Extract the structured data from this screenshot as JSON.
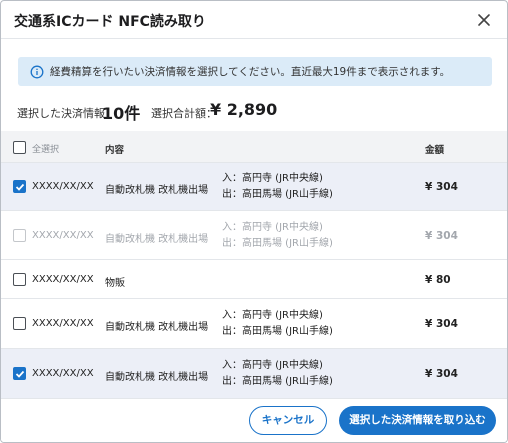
{
  "dialog": {
    "title": "交通系ICカード NFC読み取り",
    "close_icon": "close-icon"
  },
  "info": {
    "icon": "info-icon",
    "text": "経費精算を行いたい決済情報を選択してください。直近最大19件まで表示されます。"
  },
  "summary": {
    "selected_label": "選択した決済情報：",
    "selected_count": "10件",
    "total_label": "選択合計額：",
    "total_value": "¥ 2,890"
  },
  "table": {
    "select_all_label": "全選択",
    "content_header": "内容",
    "amount_header": "金額",
    "rows": [
      {
        "date": "XXXX/XX/XX",
        "content": "自動改札機 改札機出場",
        "route_in": "入：高円寺 (JR中央線)",
        "route_out": "出：高田馬場 (JR山手線)",
        "amount": "¥ 304",
        "checked": true,
        "disabled": false
      },
      {
        "date": "XXXX/XX/XX",
        "content": "自動改札機 改札機出場",
        "route_in": "入：高円寺 (JR中央線)",
        "route_out": "出：高田馬場 (JR山手線)",
        "amount": "¥ 304",
        "checked": false,
        "disabled": true
      },
      {
        "date": "XXXX/XX/XX",
        "content": "物販",
        "route_in": "",
        "route_out": "",
        "amount": "¥ 80",
        "checked": false,
        "disabled": false
      },
      {
        "date": "XXXX/XX/XX",
        "content": "自動改札機 改札機出場",
        "route_in": "入：高円寺 (JR中央線)",
        "route_out": "出：高田馬場 (JR山手線)",
        "amount": "¥ 304",
        "checked": false,
        "disabled": false
      },
      {
        "date": "XXXX/XX/XX",
        "content": "自動改札機 改札機出場",
        "route_in": "入：高円寺 (JR中央線)",
        "route_out": "出：高田馬場 (JR山手線)",
        "amount": "¥ 304",
        "checked": true,
        "disabled": false
      }
    ]
  },
  "footer": {
    "cancel_label": "キャンセル",
    "import_label": "選択した決済情報を取り込む"
  },
  "colors": {
    "accent": "#1a73c9",
    "info_bg": "#dbebf8",
    "selected_row_bg": "#eceff7"
  }
}
